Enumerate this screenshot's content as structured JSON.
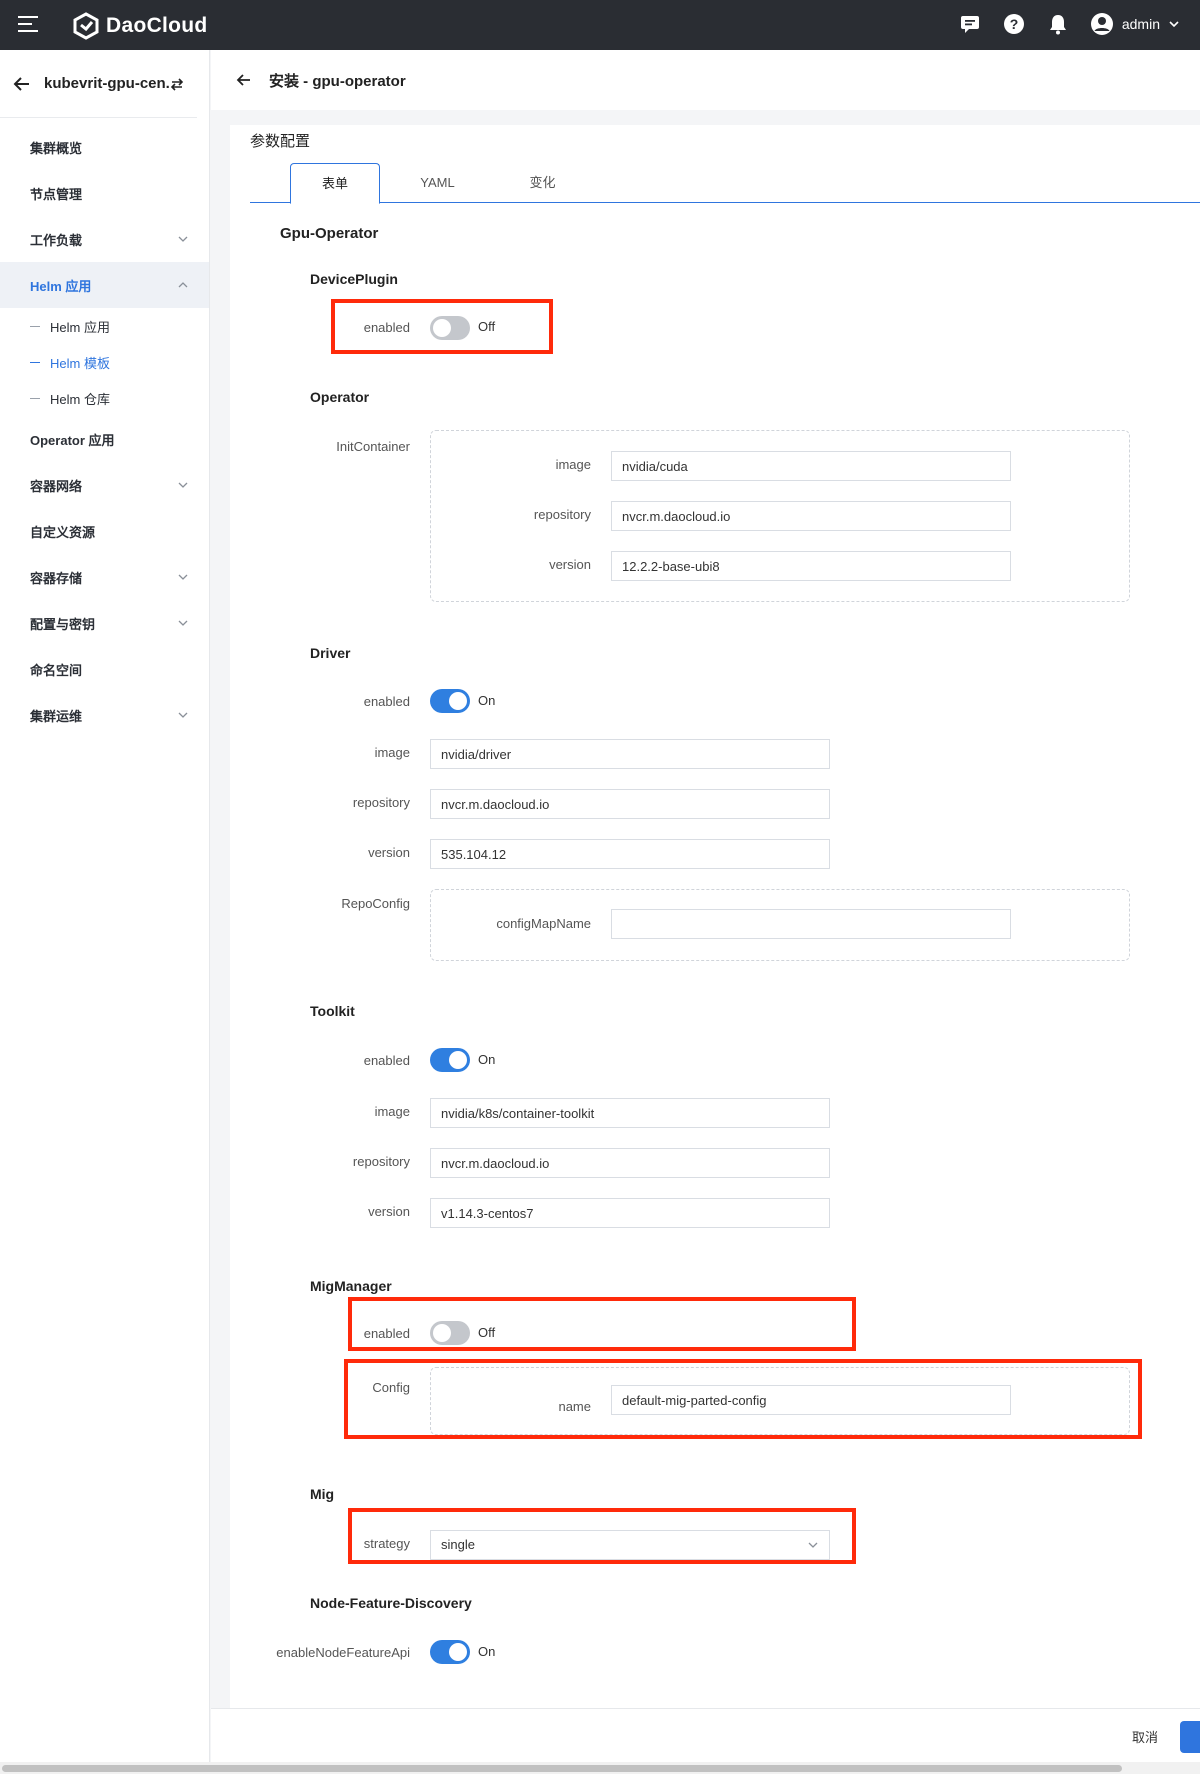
{
  "topbar": {
    "brand": "DaoCloud",
    "user": "admin"
  },
  "sidebar": {
    "cluster": "kubevrit-gpu-cen...",
    "items": [
      {
        "label": "集群概览"
      },
      {
        "label": "节点管理"
      },
      {
        "label": "工作负载"
      },
      {
        "label": "Helm 应用"
      },
      {
        "label": "Operator 应用"
      },
      {
        "label": "容器网络"
      },
      {
        "label": "自定义资源"
      },
      {
        "label": "容器存储"
      },
      {
        "label": "配置与密钥"
      },
      {
        "label": "命名空间"
      },
      {
        "label": "集群运维"
      }
    ],
    "sub_items": [
      {
        "label": "Helm 应用"
      },
      {
        "label": "Helm 模板"
      },
      {
        "label": "Helm 仓库"
      }
    ]
  },
  "header": {
    "title": "安装 - gpu-operator"
  },
  "config": {
    "section_title": "参数配置",
    "tabs": [
      "表单",
      "YAML",
      "变化"
    ],
    "root_title": "Gpu-Operator",
    "device_plugin": {
      "title": "DevicePlugin",
      "enabled_label": "enabled",
      "enabled_state": "Off"
    },
    "operator": {
      "title": "Operator",
      "init_container_label": "InitContainer",
      "image_label": "image",
      "image_value": "nvidia/cuda",
      "repository_label": "repository",
      "repository_value": "nvcr.m.daocloud.io",
      "version_label": "version",
      "version_value": "12.2.2-base-ubi8"
    },
    "driver": {
      "title": "Driver",
      "enabled_label": "enabled",
      "enabled_state": "On",
      "image_label": "image",
      "image_value": "nvidia/driver",
      "repository_label": "repository",
      "repository_value": "nvcr.m.daocloud.io",
      "version_label": "version",
      "version_value": "535.104.12",
      "repo_config_label": "RepoConfig",
      "config_map_label": "configMapName",
      "config_map_value": ""
    },
    "toolkit": {
      "title": "Toolkit",
      "enabled_label": "enabled",
      "enabled_state": "On",
      "image_label": "image",
      "image_value": "nvidia/k8s/container-toolkit",
      "repository_label": "repository",
      "repository_value": "nvcr.m.daocloud.io",
      "version_label": "version",
      "version_value": "v1.14.3-centos7"
    },
    "mig_manager": {
      "title": "MigManager",
      "enabled_label": "enabled",
      "enabled_state": "Off",
      "config_label": "Config",
      "name_label": "name",
      "name_value": "default-mig-parted-config"
    },
    "mig": {
      "title": "Mig",
      "strategy_label": "strategy",
      "strategy_value": "single"
    },
    "nfd": {
      "title": "Node-Feature-Discovery",
      "api_label": "enableNodeFeatureApi",
      "api_state": "On"
    }
  },
  "footer": {
    "cancel_label": "取消"
  },
  "colors": {
    "accent": "#2f75de",
    "highlight": "#ff2a0a",
    "topbar": "#2a2d33"
  }
}
